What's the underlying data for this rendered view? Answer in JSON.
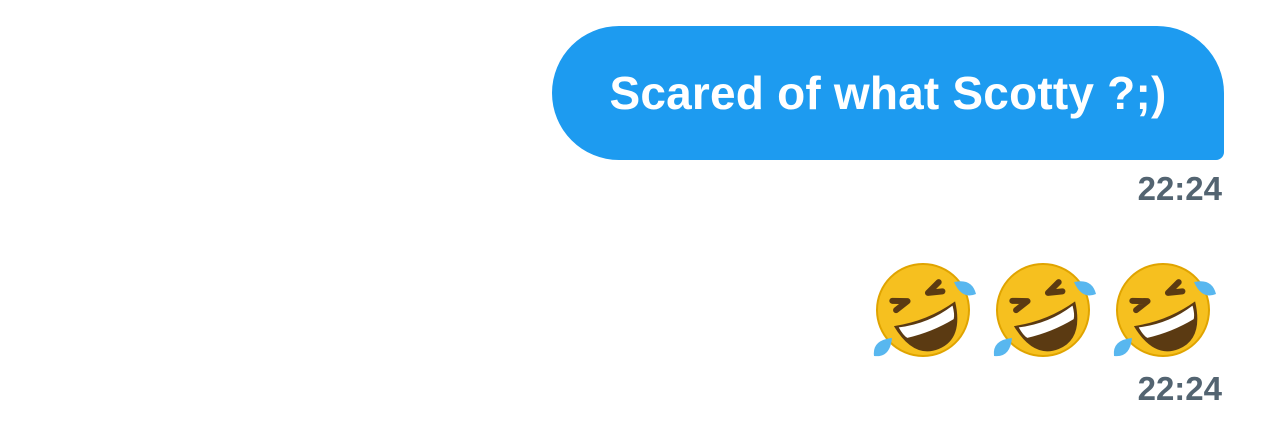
{
  "messages": [
    {
      "type": "text",
      "text": "Scared of what Scotty ?;)",
      "time": "22:24",
      "color": "#1d9bf0"
    },
    {
      "type": "emoji",
      "emojis": [
        "rolling-on-floor-laughing-icon",
        "rolling-on-floor-laughing-icon",
        "rolling-on-floor-laughing-icon"
      ],
      "time": "22:24"
    }
  ],
  "colors": {
    "bubble": "#1d9bf0",
    "bubble_text": "#ffffff",
    "timestamp": "#536471",
    "background": "#ffffff"
  }
}
